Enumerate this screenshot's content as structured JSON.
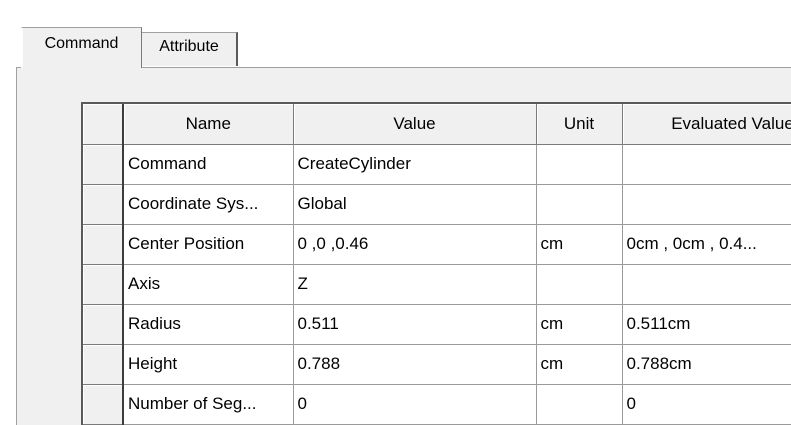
{
  "tabs": [
    {
      "label": "Command",
      "active": true
    },
    {
      "label": "Attribute",
      "active": false
    }
  ],
  "table": {
    "headers": {
      "name": "Name",
      "value": "Value",
      "unit": "Unit",
      "evaluated": "Evaluated Value"
    },
    "rows": [
      {
        "name": "Command",
        "value": "CreateCylinder",
        "unit": "",
        "evaluated": ""
      },
      {
        "name": "Coordinate Sys...",
        "value": "Global",
        "unit": "",
        "evaluated": ""
      },
      {
        "name": "Center Position",
        "value": "0 ,0 ,0.46",
        "unit": "cm",
        "evaluated": "0cm , 0cm , 0.4..."
      },
      {
        "name": "Axis",
        "value": "Z",
        "unit": "",
        "evaluated": ""
      },
      {
        "name": "Radius",
        "value": "0.511",
        "unit": "cm",
        "evaluated": "0.511cm"
      },
      {
        "name": "Height",
        "value": "0.788",
        "unit": "cm",
        "evaluated": "0.788cm"
      },
      {
        "name": "Number of Seg...",
        "value": "0",
        "unit": "",
        "evaluated": "0"
      }
    ]
  }
}
